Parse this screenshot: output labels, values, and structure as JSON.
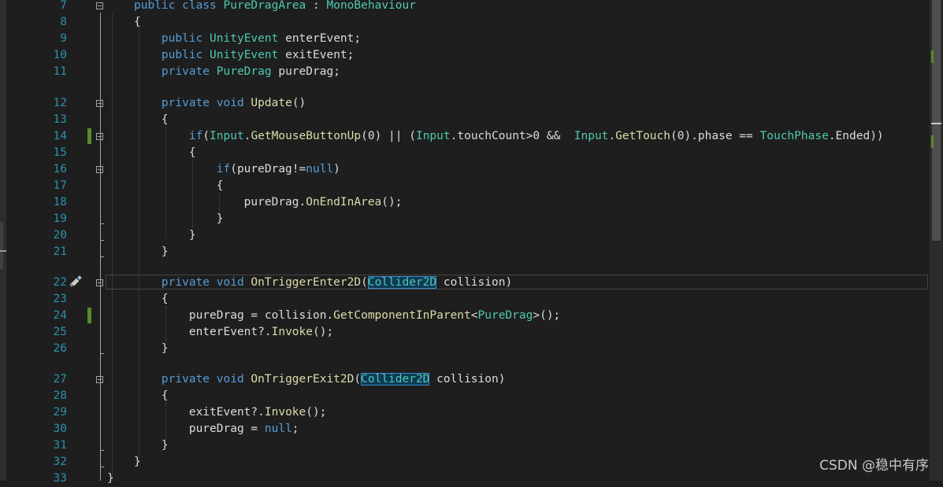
{
  "editor": {
    "line_numbers": [
      "7",
      "8",
      "9",
      "10",
      "11",
      "12",
      "13",
      "14",
      "15",
      "16",
      "17",
      "18",
      "19",
      "20",
      "21",
      "22",
      "23",
      "24",
      "25",
      "26",
      "27",
      "28",
      "29",
      "30",
      "31",
      "32",
      "33"
    ],
    "lines": [
      {
        "ln": "7",
        "tokens": [
          {
            "t": "public",
            "c": "kw"
          },
          {
            "t": " ",
            "c": "pl"
          },
          {
            "t": "class",
            "c": "kw"
          },
          {
            "t": " ",
            "c": "pl"
          },
          {
            "t": "PureDragArea",
            "c": "ty"
          },
          {
            "t": " : ",
            "c": "pl"
          },
          {
            "t": "MonoBehaviour",
            "c": "ty"
          }
        ]
      },
      {
        "ln": "8",
        "tokens": [
          {
            "t": "{",
            "c": "pl"
          }
        ]
      },
      {
        "ln": "9",
        "tokens": [
          {
            "t": "    public",
            "c": "kw"
          },
          {
            "t": " ",
            "c": "pl"
          },
          {
            "t": "UnityEvent",
            "c": "ty"
          },
          {
            "t": " enterEvent;",
            "c": "pl"
          }
        ]
      },
      {
        "ln": "10",
        "tokens": [
          {
            "t": "    public",
            "c": "kw"
          },
          {
            "t": " ",
            "c": "pl"
          },
          {
            "t": "UnityEvent",
            "c": "ty"
          },
          {
            "t": " exitEvent;",
            "c": "pl"
          }
        ]
      },
      {
        "ln": "11",
        "tokens": [
          {
            "t": "    private",
            "c": "kw"
          },
          {
            "t": " ",
            "c": "pl"
          },
          {
            "t": "PureDrag",
            "c": "ty"
          },
          {
            "t": " pureDrag;",
            "c": "pl"
          }
        ]
      },
      {
        "ln": "12",
        "tokens": [
          {
            "t": "    private",
            "c": "kw"
          },
          {
            "t": " ",
            "c": "pl"
          },
          {
            "t": "void",
            "c": "kw"
          },
          {
            "t": " ",
            "c": "pl"
          },
          {
            "t": "Update",
            "c": "me"
          },
          {
            "t": "()",
            "c": "pl"
          }
        ]
      },
      {
        "ln": "13",
        "tokens": [
          {
            "t": "    {",
            "c": "pl"
          }
        ]
      },
      {
        "ln": "14",
        "tokens": [
          {
            "t": "        if",
            "c": "kw"
          },
          {
            "t": "(",
            "c": "pl"
          },
          {
            "t": "Input",
            "c": "ty"
          },
          {
            "t": ".",
            "c": "pl"
          },
          {
            "t": "GetMouseButtonUp",
            "c": "me"
          },
          {
            "t": "(0) || (",
            "c": "pl"
          },
          {
            "t": "Input",
            "c": "ty"
          },
          {
            "t": ".touchCount>0 &&  ",
            "c": "pl"
          },
          {
            "t": "Input",
            "c": "ty"
          },
          {
            "t": ".",
            "c": "pl"
          },
          {
            "t": "GetTouch",
            "c": "me"
          },
          {
            "t": "(0).phase == ",
            "c": "pl"
          },
          {
            "t": "TouchPhase",
            "c": "ty"
          },
          {
            "t": ".Ended))",
            "c": "pl"
          }
        ]
      },
      {
        "ln": "15",
        "tokens": [
          {
            "t": "        {",
            "c": "pl"
          }
        ]
      },
      {
        "ln": "16",
        "tokens": [
          {
            "t": "            if",
            "c": "kw"
          },
          {
            "t": "(pureDrag!=",
            "c": "pl"
          },
          {
            "t": "null",
            "c": "kw"
          },
          {
            "t": ")",
            "c": "pl"
          }
        ]
      },
      {
        "ln": "17",
        "tokens": [
          {
            "t": "            {",
            "c": "pl"
          }
        ]
      },
      {
        "ln": "18",
        "tokens": [
          {
            "t": "                pureDrag.",
            "c": "pl"
          },
          {
            "t": "OnEndInArea",
            "c": "me"
          },
          {
            "t": "();",
            "c": "pl"
          }
        ]
      },
      {
        "ln": "19",
        "tokens": [
          {
            "t": "            }",
            "c": "pl"
          }
        ]
      },
      {
        "ln": "20",
        "tokens": [
          {
            "t": "        }",
            "c": "pl"
          }
        ]
      },
      {
        "ln": "21",
        "tokens": [
          {
            "t": "    }",
            "c": "pl"
          }
        ]
      },
      {
        "ln": "22",
        "tokens": [
          {
            "t": "    private",
            "c": "kw"
          },
          {
            "t": " ",
            "c": "pl"
          },
          {
            "t": "void",
            "c": "kw"
          },
          {
            "t": " ",
            "c": "pl"
          },
          {
            "t": "OnTriggerEnter2D",
            "c": "me"
          },
          {
            "t": "(",
            "c": "pl"
          },
          {
            "t": "Collider2D",
            "c": "hl"
          },
          {
            "t": " collision)",
            "c": "pl"
          }
        ]
      },
      {
        "ln": "23",
        "tokens": [
          {
            "t": "    {",
            "c": "pl"
          }
        ]
      },
      {
        "ln": "24",
        "tokens": [
          {
            "t": "        pureDrag = collision.",
            "c": "pl"
          },
          {
            "t": "GetComponentInParent",
            "c": "me"
          },
          {
            "t": "<",
            "c": "pl"
          },
          {
            "t": "PureDrag",
            "c": "ty"
          },
          {
            "t": ">();",
            "c": "pl"
          }
        ]
      },
      {
        "ln": "25",
        "tokens": [
          {
            "t": "        enterEvent?.",
            "c": "pl"
          },
          {
            "t": "Invoke",
            "c": "me"
          },
          {
            "t": "();",
            "c": "pl"
          }
        ]
      },
      {
        "ln": "26",
        "tokens": [
          {
            "t": "    }",
            "c": "pl"
          }
        ]
      },
      {
        "ln": "27",
        "tokens": [
          {
            "t": "    private",
            "c": "kw"
          },
          {
            "t": " ",
            "c": "pl"
          },
          {
            "t": "void",
            "c": "kw"
          },
          {
            "t": " ",
            "c": "pl"
          },
          {
            "t": "OnTriggerExit2D",
            "c": "me"
          },
          {
            "t": "(",
            "c": "pl"
          },
          {
            "t": "Collider2D",
            "c": "hl"
          },
          {
            "t": " collision)",
            "c": "pl"
          }
        ]
      },
      {
        "ln": "28",
        "tokens": [
          {
            "t": "    {",
            "c": "pl"
          }
        ]
      },
      {
        "ln": "29",
        "tokens": [
          {
            "t": "        exitEvent?.",
            "c": "pl"
          },
          {
            "t": "Invoke",
            "c": "me"
          },
          {
            "t": "();",
            "c": "pl"
          }
        ]
      },
      {
        "ln": "30",
        "tokens": [
          {
            "t": "        pureDrag = ",
            "c": "pl"
          },
          {
            "t": "null",
            "c": "kw"
          },
          {
            "t": ";",
            "c": "pl"
          }
        ]
      },
      {
        "ln": "31",
        "tokens": [
          {
            "t": "    }",
            "c": "pl"
          }
        ]
      },
      {
        "ln": "32",
        "tokens": [
          {
            "t": "}",
            "c": "pl"
          }
        ]
      },
      {
        "ln": "33",
        "tokens": [
          {
            "t": "}",
            "c": "pl"
          }
        ]
      }
    ],
    "current_line": "22",
    "highlighted_symbol": "Collider2D",
    "gutter_icon": "pencil-icon"
  },
  "theme": {
    "background": "#1e1e1e",
    "keyword": "#569cd6",
    "type": "#4ec9b0",
    "method": "#dcdcaa",
    "text": "#dcdcdc",
    "line_number": "#2b91af",
    "change_marker": "#5a8a2a"
  },
  "watermark": {
    "text": "CSDN @稳中有序"
  }
}
